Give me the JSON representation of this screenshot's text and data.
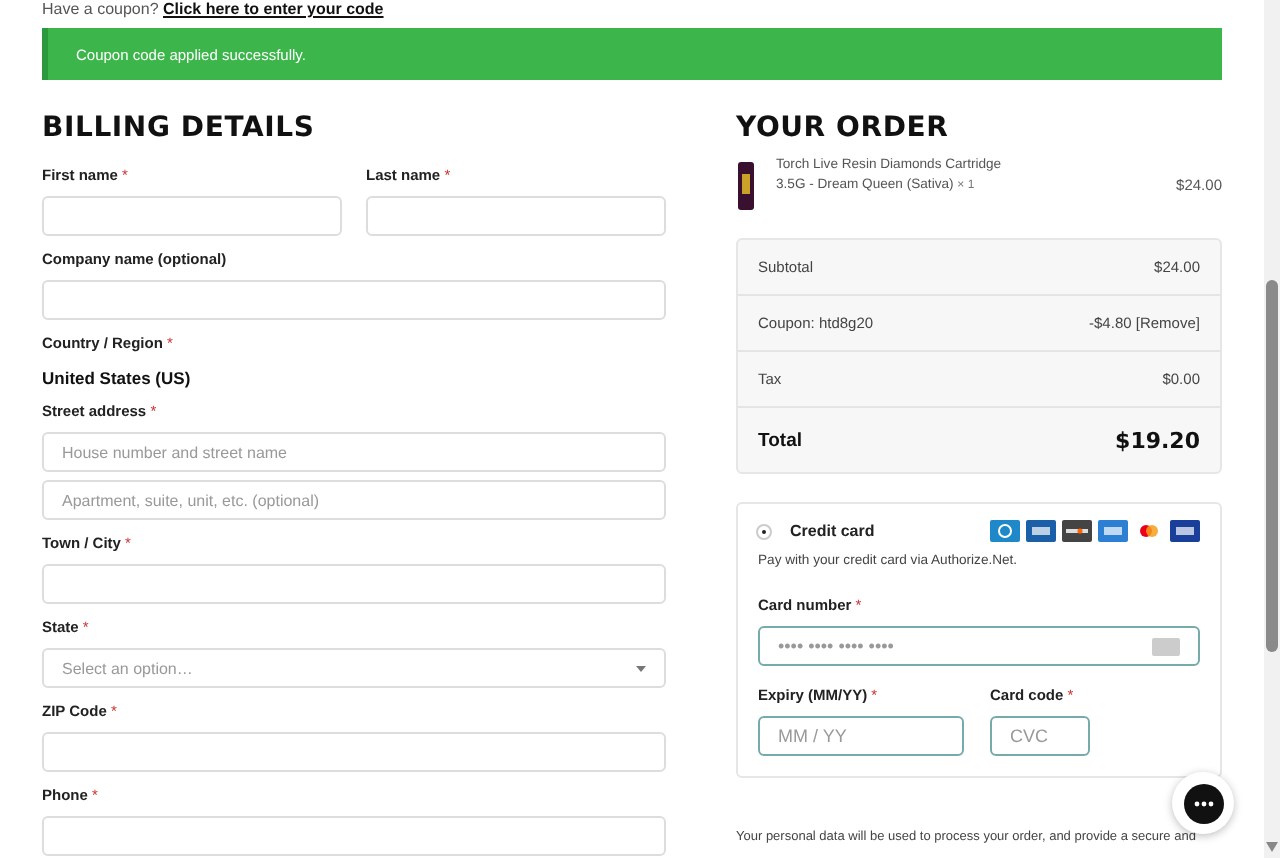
{
  "coupon_prompt": {
    "text": "Have a coupon?",
    "link": "Click here to enter your code"
  },
  "notice": {
    "kind": "success",
    "text": "Coupon code applied successfully."
  },
  "billing": {
    "title": "BILLING DETAILS",
    "fields": [
      {
        "kind": "pair",
        "fields": [
          {
            "kind": "text",
            "label": "First name",
            "mark": "*"
          },
          {
            "kind": "text",
            "label": "Last name",
            "mark": "*"
          }
        ]
      },
      {
        "kind": "text",
        "label": "Company name (optional)"
      },
      {
        "kind": "static",
        "label": "Country / Region",
        "mark": "*",
        "value": "United States (US)"
      },
      {
        "kind": "text",
        "label": "Street address",
        "mark": "*",
        "inputs": [
          {
            "placeholder": "House number and street name"
          },
          {
            "placeholder": "Apartment, suite, unit, etc. (optional)"
          }
        ]
      },
      {
        "kind": "text",
        "label": "Town / City",
        "mark": "*"
      },
      {
        "kind": "select",
        "label": "State",
        "mark": "*",
        "placeholder": "Select an option…"
      },
      {
        "kind": "text",
        "label": "ZIP Code",
        "mark": "*"
      },
      {
        "kind": "text",
        "label": "Phone",
        "mark": "*"
      }
    ]
  },
  "order": {
    "title": "YOUR ORDER",
    "product": {
      "name": "Torch Live Resin Diamonds Cartridge 3.5G - Dream Queen (Sativa)",
      "quantity": "× 1",
      "price": "$24.00"
    },
    "totals": [
      {
        "kind": "normal",
        "label": "Subtotal",
        "value": "$24.00"
      },
      {
        "kind": "coupon",
        "label": "Coupon: htd8g20",
        "value": "-$4.80",
        "link": "[Remove]"
      },
      {
        "kind": "normal",
        "label": "Tax",
        "value": "$0.00"
      },
      {
        "kind": "total",
        "label": "Total",
        "value": "$19.20"
      }
    ],
    "payment": {
      "method": "Credit card",
      "selected": true,
      "description": "Pay with your credit card via Authorize.Net.",
      "card_number": {
        "label": "Card number",
        "mark": "*",
        "placeholder": "•••• •••• •••• ••••"
      },
      "expiry": {
        "label": "Expiry (MM/YY)",
        "mark": "*",
        "placeholder": "MM / YY"
      },
      "cvc": {
        "label": "Card code",
        "mark": "*",
        "placeholder": "CVC"
      }
    },
    "privacy": "Your personal data will be used to process your order, and provide a secure and"
  }
}
